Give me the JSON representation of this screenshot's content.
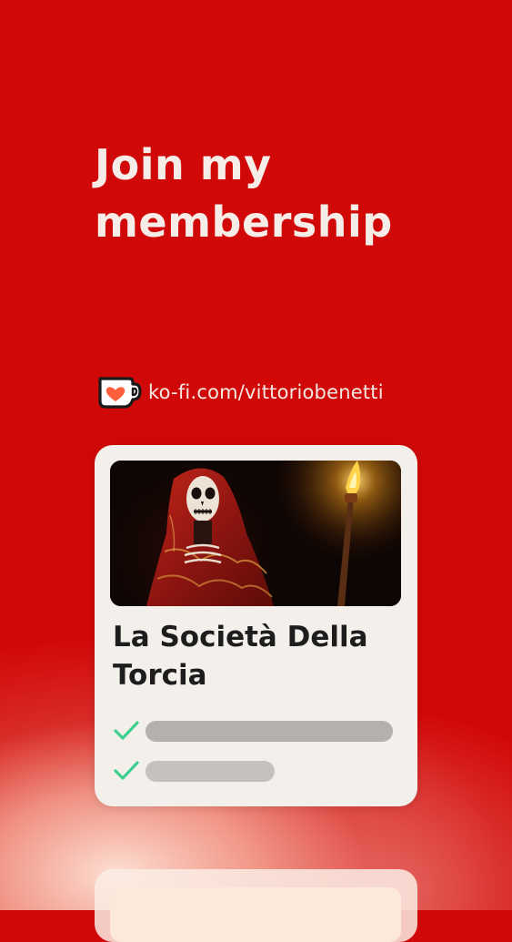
{
  "headline": {
    "line1": "Join my",
    "line2": "membership"
  },
  "kofi": {
    "logo_icon": "ko-fi-cup-heart-icon",
    "url": "ko-fi.com/vittoriobenetti"
  },
  "membership_card": {
    "image_icon": "skull-face-figure-with-torch-image",
    "title_line1": "La Società Della",
    "title_line2": "Torcia",
    "perks": [
      {
        "icon": "check-icon",
        "check_color": "#3ecf8e"
      },
      {
        "icon": "check-icon",
        "check_color": "#3ecf8e"
      }
    ]
  },
  "colors": {
    "background": "#d10808",
    "card": "#f3efea",
    "headline_text": "#f7ede8",
    "title_text": "#1d1d1d",
    "check": "#3ecf8e"
  }
}
